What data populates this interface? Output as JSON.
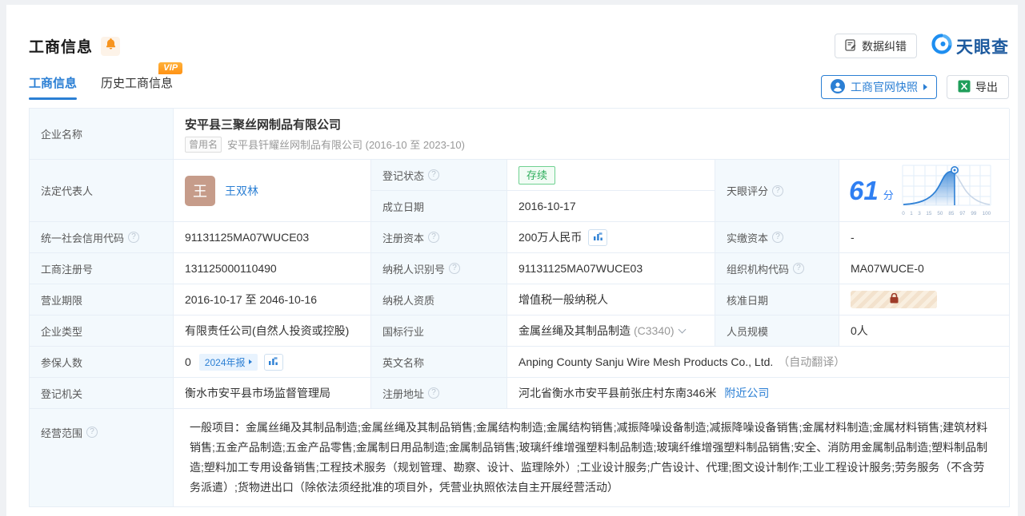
{
  "icons": {
    "help": "?"
  },
  "header": {
    "title": "工商信息",
    "correction": "数据纠错",
    "logo": "天眼查"
  },
  "tabs": {
    "current": "工商信息",
    "history": "历史工商信息",
    "vip": "VIP"
  },
  "actions": {
    "snapshot": "工商官网快照",
    "export": "导出"
  },
  "info": {
    "company_name": {
      "label": "企业名称",
      "value": "安平县三聚丝网制品有限公司",
      "former_tag": "曾用名",
      "former": "安平县钎耀丝网制品有限公司 (2016-10 至 2023-10)"
    },
    "legal_rep": {
      "label": "法定代表人",
      "avatar": "王",
      "name": "王双林"
    },
    "reg_status": {
      "label": "登记状态",
      "value": "存续"
    },
    "establish_date": {
      "label": "成立日期",
      "value": "2016-10-17"
    },
    "score": {
      "label": "天眼评分",
      "value": "61",
      "unit": "分"
    },
    "credit_code": {
      "label": "统一社会信用代码",
      "value": "91131125MA07WUCE03"
    },
    "reg_capital": {
      "label": "注册资本",
      "value": "200万人民币"
    },
    "paid_capital": {
      "label": "实缴资本",
      "value": "-"
    },
    "reg_number": {
      "label": "工商注册号",
      "value": "131125000110490"
    },
    "taxpayer_id": {
      "label": "纳税人识别号",
      "value": "91131125MA07WUCE03"
    },
    "org_code": {
      "label": "组织机构代码",
      "value": "MA07WUCE-0"
    },
    "business_term": {
      "label": "营业期限",
      "value": "2016-10-17 至 2046-10-16"
    },
    "taxpayer_quality": {
      "label": "纳税人资质",
      "value": "增值税一般纳税人"
    },
    "approval_date": {
      "label": "核准日期"
    },
    "company_type": {
      "label": "企业类型",
      "value": "有限责任公司(自然人投资或控股)"
    },
    "industry": {
      "label": "国标行业",
      "value": "金属丝绳及其制品制造",
      "code": "(C3340)"
    },
    "staff_size": {
      "label": "人员规模",
      "value": "0人"
    },
    "insured": {
      "label": "参保人数",
      "value": "0",
      "report_badge": "2024年报"
    },
    "english_name": {
      "label": "英文名称",
      "value": "Anping County Sanju Wire Mesh Products Co., Ltd.",
      "note": "（自动翻译）"
    },
    "reg_authority": {
      "label": "登记机关",
      "value": "衡水市安平县市场监督管理局"
    },
    "reg_address": {
      "label": "注册地址",
      "value": "河北省衡水市安平县前张庄村东南346米",
      "link": "附近公司"
    },
    "business_scope": {
      "label": "经营范围",
      "value": "一般项目：金属丝绳及其制品制造;金属丝绳及其制品销售;金属结构制造;金属结构销售;减振降噪设备制造;减振降噪设备销售;金属材料制造;金属材料销售;建筑材料销售;五金产品制造;五金产品零售;金属制日用品制造;金属制品销售;玻璃纤维增强塑料制品制造;玻璃纤维增强塑料制品销售;安全、消防用金属制品制造;塑料制品制造;塑料加工专用设备销售;工程技术服务（规划管理、勘察、设计、监理除外）;工业设计服务;广告设计、代理;图文设计制作;工业工程设计服务;劳务服务（不含劳务派遣）;货物进出口（除依法须经批准的项目外，凭营业执照依法自主开展经营活动）"
    }
  },
  "chart_data": {
    "type": "area",
    "title": "天眼评分",
    "score": 61,
    "score_unit": "分",
    "x_ticks": [
      "0",
      "1",
      "3",
      "15",
      "50",
      "85",
      "97",
      "99",
      "100"
    ],
    "xlim": [
      0,
      100
    ],
    "marker_value": 61,
    "grid": true,
    "series": [
      {
        "name": "score-distribution-bell-curve",
        "fill_color_left_of_marker": "#2f81d6",
        "line_color_right_of_marker": "#c9d7e8"
      }
    ]
  }
}
